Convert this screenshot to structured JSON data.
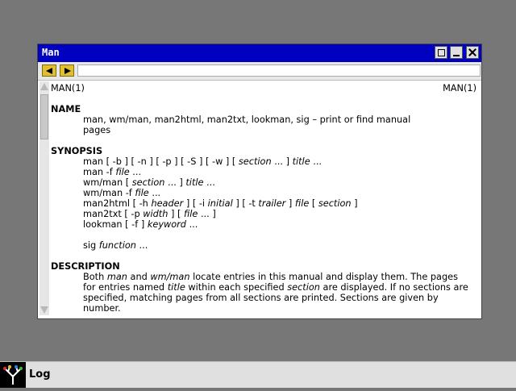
{
  "window": {
    "title": "Man"
  },
  "header": {
    "left": "MAN(1)",
    "right": "MAN(1)"
  },
  "sections": {
    "name_heading": "NAME",
    "name_text_1": "man, wm/man, man2html, man2txt, lookman, sig – print or find manual",
    "name_text_2": "pages",
    "synopsis_heading": "SYNOPSIS",
    "synopsis": [
      {
        "a": "man [ -b ] [ -n ] [ -p ] [ -S ] [ -w ] [ ",
        "b": "section",
        "c": " ... ] ",
        "d": "title",
        "e": " ..."
      },
      {
        "a": "man  -f ",
        "b": "file",
        "c": " ...",
        "d": "",
        "e": ""
      },
      {
        "a": "wm/man [ ",
        "b": "section",
        "c": " ... ] ",
        "d": "title",
        "e": " ..."
      },
      {
        "a": "wm/man  -f ",
        "b": "file",
        "c": " ...",
        "d": "",
        "e": ""
      },
      {
        "a": "man2html [ -h ",
        "b": "header",
        "c": " ] [ -i ",
        "d": "initial",
        "e": " ] [ -t "
      },
      {
        "a": "man2txt [ -p ",
        "b": "width",
        "c": " ] [ ",
        "d": "file",
        "e": " ... ]"
      },
      {
        "a": "lookman [ -f ] ",
        "b": "keyword",
        "c": " ...",
        "d": "",
        "e": ""
      },
      {
        "a": "sig ",
        "b": "function",
        "c": " ...",
        "d": "",
        "e": ""
      }
    ],
    "man2html_tail": {
      "a": "trailer",
      "b": " ] ",
      "c": "file",
      "d": " [ ",
      "e": "section",
      "f": " ]"
    },
    "description_heading": "DESCRIPTION",
    "description": {
      "p1": "Both ",
      "p2": "man",
      "p3": " and ",
      "p4": "wm/man",
      "p5": " locate entries in this manual and display them. The pages for entries named ",
      "p6": "title",
      "p7": " within each specified ",
      "p8": "section",
      "p9": " are displayed. If no sections are specified, matching pages from all sections are printed. Sections are given by number."
    }
  },
  "taskbar": {
    "item_label": "Log"
  }
}
